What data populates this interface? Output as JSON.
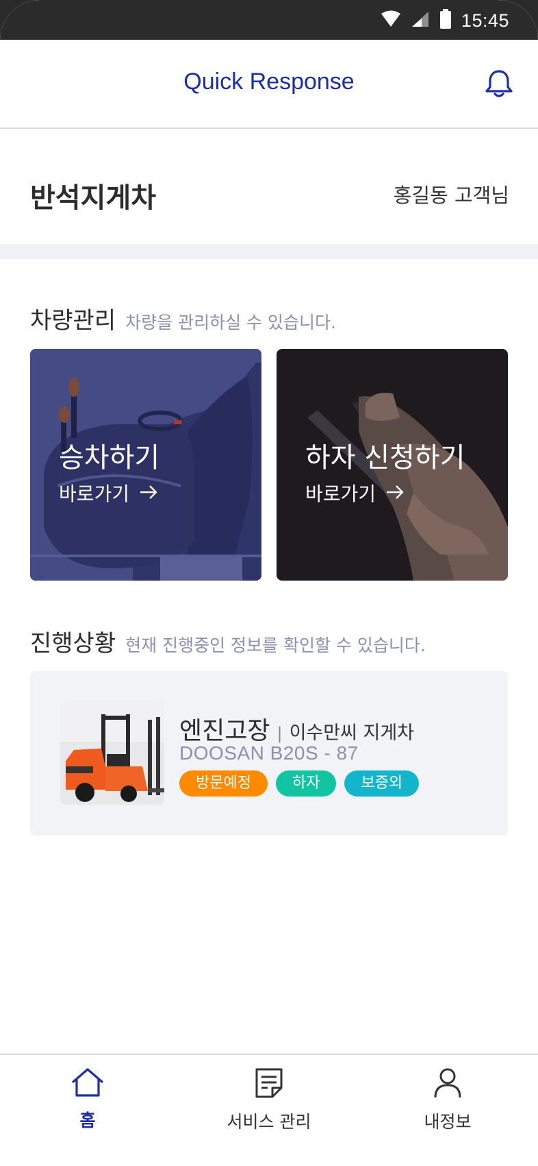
{
  "status_bar": {
    "time": "15:45"
  },
  "header": {
    "title": "Quick Response"
  },
  "company": {
    "name": "반석지게차",
    "customer": "홍길동 고객님"
  },
  "vehicle_section": {
    "title": "차량관리",
    "subtitle": "차량을 관리하실 수 있습니다.",
    "cards": [
      {
        "title": "승차하기",
        "link": "바로가기"
      },
      {
        "title": "하자 신청하기",
        "link": "바로가기"
      }
    ]
  },
  "progress_section": {
    "title": "진행상황",
    "subtitle": "현재 진행중인 정보를 확인할 수 있습니다.",
    "item": {
      "title": "엔진고장",
      "separator": "|",
      "owner": "이수만씨 지게차",
      "model": "DOOSAN B20S - 87",
      "tags": [
        {
          "label": "방문예정",
          "color": "#ff8a00"
        },
        {
          "label": "하자",
          "color": "#13c4a3"
        },
        {
          "label": "보증외",
          "color": "#12b5cb"
        }
      ]
    }
  },
  "bottom_nav": {
    "items": [
      {
        "label": "홈",
        "icon": "home-icon",
        "active": true
      },
      {
        "label": "서비스 관리",
        "icon": "document-icon",
        "active": false
      },
      {
        "label": "내정보",
        "icon": "user-icon",
        "active": false
      }
    ]
  },
  "colors": {
    "accent": "#1c2ea6",
    "status_bar": "#2b2b2b",
    "subtitle": "#8a90b3",
    "card_bg": "#f2f3f7"
  }
}
